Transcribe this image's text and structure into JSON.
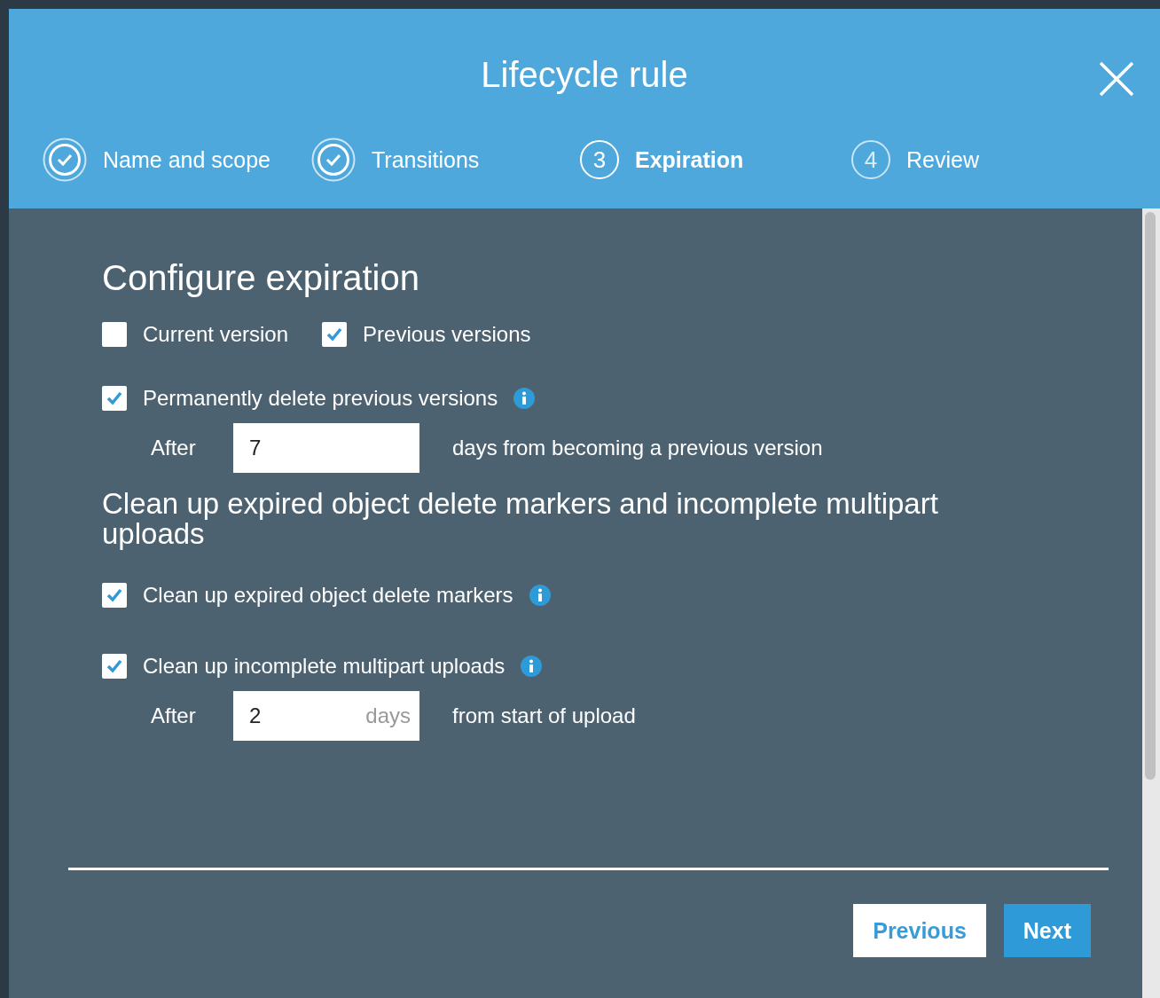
{
  "dialog": {
    "title": "Lifecycle rule"
  },
  "steps": [
    {
      "label": "Name and scope",
      "kind": "done"
    },
    {
      "label": "Transitions",
      "kind": "done"
    },
    {
      "label": "Expiration",
      "kind": "current",
      "number": "3"
    },
    {
      "label": "Review",
      "kind": "upcoming",
      "number": "4"
    }
  ],
  "expiration": {
    "title": "Configure expiration",
    "versions": [
      {
        "label": "Current version",
        "checked": false
      },
      {
        "label": "Previous versions",
        "checked": true
      }
    ],
    "rules": [
      {
        "label": "Permanently delete previous versions",
        "checked": true,
        "after": {
          "label": "After",
          "value": "7",
          "suffix": "days from becoming a previous version"
        }
      }
    ]
  },
  "cleanup": {
    "title": "Clean up expired object delete markers and incomplete multipart uploads",
    "rules": [
      {
        "label": "Clean up expired object delete markers",
        "checked": true
      },
      {
        "label": "Clean up incomplete multipart uploads",
        "checked": true,
        "after": {
          "label": "After",
          "value": "2",
          "unit": "days",
          "suffix": "from start of upload"
        }
      }
    ]
  },
  "buttons": [
    {
      "label": "Previous",
      "kind": "secondary"
    },
    {
      "label": "Next",
      "kind": "primary"
    }
  ]
}
